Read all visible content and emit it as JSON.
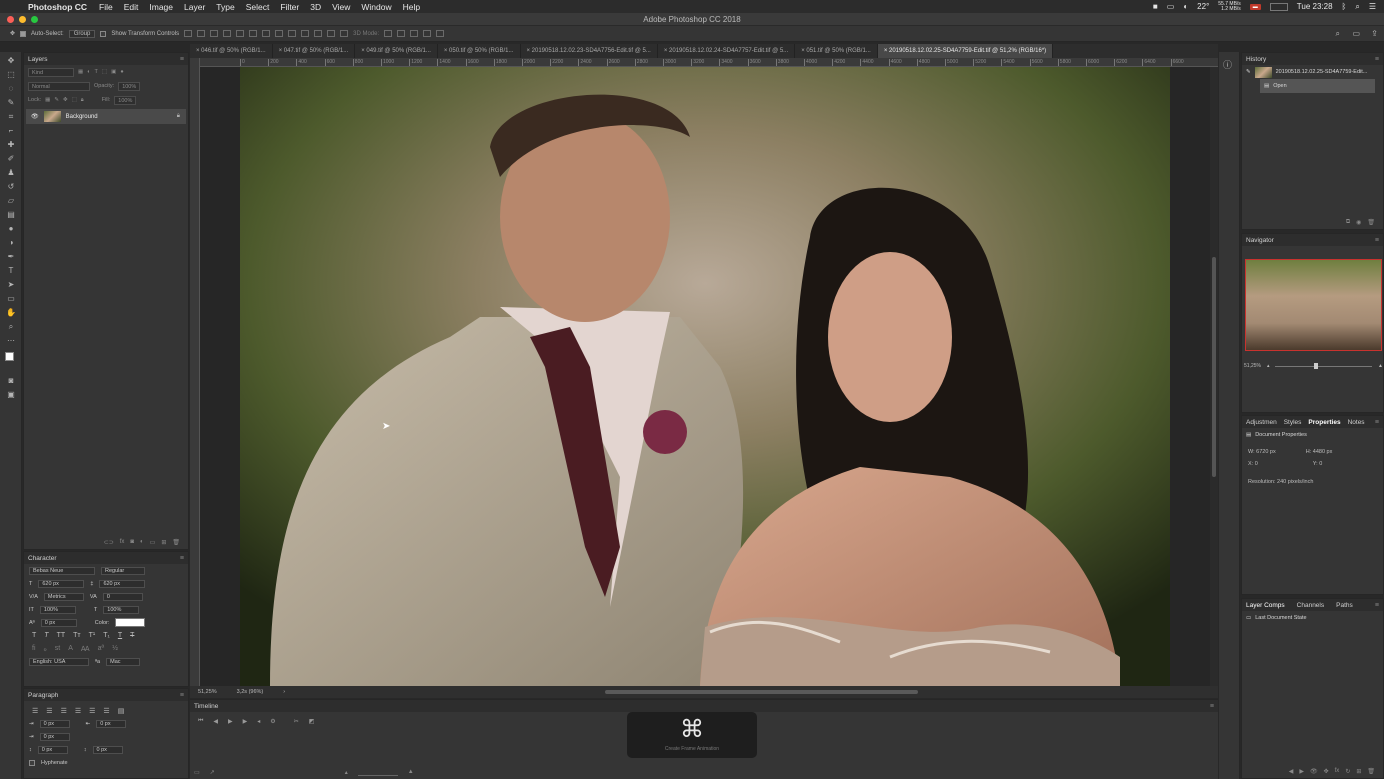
{
  "menubar": {
    "app_name": "Photoshop CC",
    "items": [
      "File",
      "Edit",
      "Image",
      "Layer",
      "Type",
      "Select",
      "Filter",
      "3D",
      "View",
      "Window",
      "Help"
    ],
    "temp": "22°",
    "net_up": "55.7 MB/s",
    "net_down": "1.2 MB/s",
    "clock": "Tue 23:28"
  },
  "window": {
    "title": "Adobe Photoshop CC 2018"
  },
  "options": {
    "auto_select": "Auto-Select:",
    "auto_select_mode": "Group",
    "show_transform": "Show Transform Controls",
    "mode_3d": "3D Mode:"
  },
  "tabs": [
    "046.tif @ 50% (RGB/1...",
    "047.tif @ 50% (RGB/1...",
    "049.tif @ 50% (RGB/1...",
    "050.tif @ 50% (RGB/1...",
    "20190518.12.02.23-SD4A7756-Edit.tif @ 5...",
    "20190518.12.02.24-SD4A7757-Edit.tif @ 5...",
    "051.tif @ 50% (RGB/1...",
    "20190518.12.02.25-SD4A7759-Edit.tif @ 51,2% (RGB/16*)"
  ],
  "ruler_ticks": [
    "0",
    "200",
    "400",
    "600",
    "800",
    "1000",
    "1200",
    "1400",
    "1600",
    "1800",
    "2000",
    "2200",
    "2400",
    "2600",
    "2800",
    "3000",
    "3200",
    "3400",
    "3600",
    "3800",
    "4000",
    "4200",
    "4400",
    "4600",
    "4800",
    "5000",
    "5200",
    "5400",
    "5600",
    "5800",
    "6000",
    "6200",
    "6400",
    "6600"
  ],
  "layers": {
    "title": "Layers",
    "kind": "Kind",
    "blend": "Normal",
    "opacity_label": "Opacity:",
    "opacity": "100%",
    "lock_label": "Lock:",
    "fill_label": "Fill:",
    "fill": "100%",
    "layer_name": "Background"
  },
  "character": {
    "title": "Character",
    "font": "Bebas Neue",
    "style": "Regular",
    "size": "620 px",
    "leading": "620 px",
    "kerning": "Metrics",
    "tracking": "0",
    "vscale": "100%",
    "hscale": "100%",
    "baseline": "0 px",
    "color_label": "Color:",
    "language": "English: USA",
    "aa": "Mac"
  },
  "paragraph": {
    "title": "Paragraph",
    "indent_left": "0 px",
    "indent_right": "0 px",
    "first_line": "0 px",
    "space_before": "0 px",
    "space_after": "0 px",
    "hyphenate": "Hyphenate"
  },
  "status": {
    "zoom": "51,25%",
    "timing": "3,2s (96%)"
  },
  "timeline": {
    "title": "Timeline",
    "hud_symbol": "⌘",
    "hud_label": "Create Frame Animation"
  },
  "history": {
    "title": "History",
    "snapshot": "20190518.12.02.25-SD4A7759-Edit...",
    "step": "Open"
  },
  "navigator": {
    "title": "Navigator",
    "zoom": "51,25%"
  },
  "properties": {
    "tabs": [
      "Adjustmen",
      "Styles",
      "Properties",
      "Notes"
    ],
    "header": "Document Properties",
    "w": "W:  6720 px",
    "h": "H:  4480 px",
    "x": "X:  0",
    "y": "Y:  0",
    "resolution": "Resolution: 240 pixels/inch"
  },
  "comps": {
    "tabs": [
      "Layer Comps",
      "Channels",
      "Paths"
    ],
    "item": "Last Document State"
  },
  "colors": {
    "accent": "#c8322e",
    "panel": "#353535",
    "bg": "#282828"
  }
}
